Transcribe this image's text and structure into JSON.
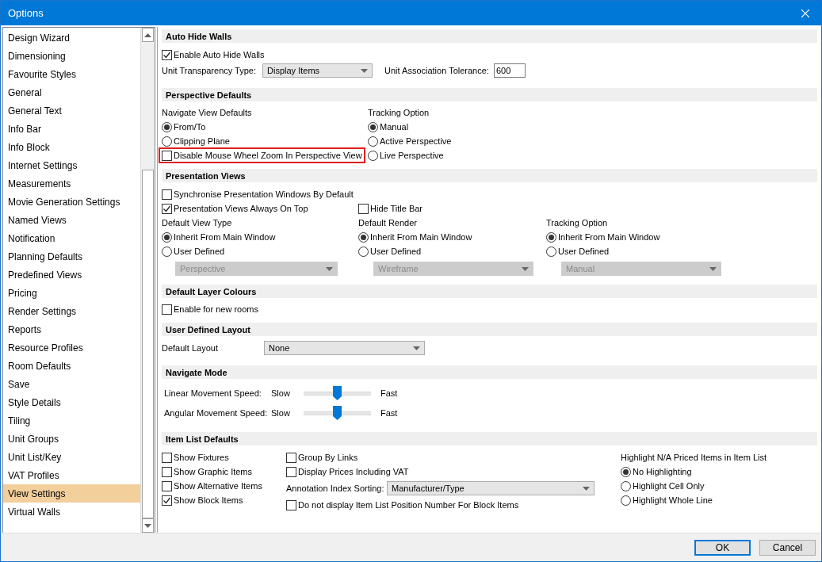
{
  "window": {
    "title": "Options"
  },
  "sidebar": {
    "items": [
      {
        "label": "Design Wizard",
        "selected": false
      },
      {
        "label": "Dimensioning",
        "selected": false
      },
      {
        "label": "Favourite Styles",
        "selected": false
      },
      {
        "label": "General",
        "selected": false
      },
      {
        "label": "General Text",
        "selected": false
      },
      {
        "label": "Info Bar",
        "selected": false
      },
      {
        "label": "Info Block",
        "selected": false
      },
      {
        "label": "Internet Settings",
        "selected": false
      },
      {
        "label": "Measurements",
        "selected": false
      },
      {
        "label": "Movie Generation Settings",
        "selected": false
      },
      {
        "label": "Named Views",
        "selected": false
      },
      {
        "label": "Notification",
        "selected": false
      },
      {
        "label": "Planning Defaults",
        "selected": false
      },
      {
        "label": "Predefined Views",
        "selected": false
      },
      {
        "label": "Pricing",
        "selected": false
      },
      {
        "label": "Render Settings",
        "selected": false
      },
      {
        "label": "Reports",
        "selected": false
      },
      {
        "label": "Resource Profiles",
        "selected": false
      },
      {
        "label": "Room Defaults",
        "selected": false
      },
      {
        "label": "Save",
        "selected": false
      },
      {
        "label": "Style Details",
        "selected": false
      },
      {
        "label": "Tiling",
        "selected": false
      },
      {
        "label": "Unit Groups",
        "selected": false
      },
      {
        "label": "Unit List/Key",
        "selected": false
      },
      {
        "label": "VAT Profiles",
        "selected": false
      },
      {
        "label": "View Settings",
        "selected": true
      },
      {
        "label": "Virtual Walls",
        "selected": false
      }
    ]
  },
  "auto_hide_walls": {
    "title": "Auto Hide Walls",
    "enable": {
      "label": "Enable Auto Hide Walls",
      "checked": true
    },
    "transparency": {
      "label": "Unit Transparency Type:",
      "value": "Display Items"
    },
    "tolerance": {
      "label": "Unit Association Tolerance:",
      "value": "600"
    }
  },
  "perspective_defaults": {
    "title": "Perspective Defaults",
    "navigate": {
      "heading": "Navigate View Defaults",
      "options": [
        {
          "label": "From/To",
          "selected": true
        },
        {
          "label": "Clipping Plane",
          "selected": false
        }
      ]
    },
    "disable_wheel": {
      "label": "Disable Mouse Wheel Zoom In Perspective View",
      "checked": false,
      "highlighted": true
    },
    "tracking": {
      "heading": "Tracking Option",
      "options": [
        {
          "label": "Manual",
          "selected": true
        },
        {
          "label": "Active Perspective",
          "selected": false
        },
        {
          "label": "Live Perspective",
          "selected": false
        }
      ]
    }
  },
  "presentation_views": {
    "title": "Presentation Views",
    "synchronise": {
      "label": "Synchronise Presentation Windows By Default",
      "checked": false
    },
    "always_on_top": {
      "label": "Presentation Views Always On Top",
      "checked": true
    },
    "hide_title_bar": {
      "label": "Hide Title Bar",
      "checked": false
    },
    "groups": [
      {
        "heading": "Default View Type",
        "options": [
          {
            "label": "Inherit From Main Window",
            "selected": true
          },
          {
            "label": "User Defined",
            "selected": false
          }
        ],
        "dropdown": {
          "value": "Perspective",
          "disabled": true
        }
      },
      {
        "heading": "Default Render",
        "options": [
          {
            "label": "Inherit From Main Window",
            "selected": true
          },
          {
            "label": "User Defined",
            "selected": false
          }
        ],
        "dropdown": {
          "value": "Wireframe",
          "disabled": true
        }
      },
      {
        "heading": "Tracking Option",
        "options": [
          {
            "label": "Inherit From Main Window",
            "selected": true
          },
          {
            "label": "User Defined",
            "selected": false
          }
        ],
        "dropdown": {
          "value": "Manual",
          "disabled": true
        }
      }
    ]
  },
  "default_layer_colours": {
    "title": "Default Layer Colours",
    "enable": {
      "label": "Enable for new rooms",
      "checked": false
    }
  },
  "user_defined_layout": {
    "title": "User Defined Layout",
    "label": "Default Layout",
    "value": "None"
  },
  "navigate_mode": {
    "title": "Navigate Mode",
    "sliders": [
      {
        "label": "Linear Movement Speed:",
        "min": "Slow",
        "max": "Fast",
        "level": 0.5
      },
      {
        "label": "Angular Movement Speed:",
        "min": "Slow",
        "max": "Fast",
        "level": 0.5
      }
    ]
  },
  "item_list_defaults": {
    "title": "Item List Defaults",
    "checks": [
      {
        "label": "Show Fixtures",
        "checked": false
      },
      {
        "label": "Show Graphic Items",
        "checked": false
      },
      {
        "label": "Show Alternative Items",
        "checked": false
      },
      {
        "label": "Show Block Items",
        "checked": true
      }
    ],
    "middle_checks": [
      {
        "label": "Group By Links",
        "checked": false
      },
      {
        "label": "Display Prices Including VAT",
        "checked": false
      }
    ],
    "sorting": {
      "label": "Annotation Index Sorting:",
      "value": "Manufacturer/Type"
    },
    "no_position": {
      "label": "Do not display Item List Position Number For Block Items",
      "checked": false
    },
    "highlight": {
      "heading": "Highlight N/A Priced Items in Item List",
      "options": [
        {
          "label": "No Highlighting",
          "selected": true
        },
        {
          "label": "Highlight Cell Only",
          "selected": false
        },
        {
          "label": "Highlight Whole Line",
          "selected": false
        }
      ]
    }
  },
  "buttons": [
    {
      "label": "OK",
      "default": true
    },
    {
      "label": "Cancel",
      "default": false
    }
  ]
}
